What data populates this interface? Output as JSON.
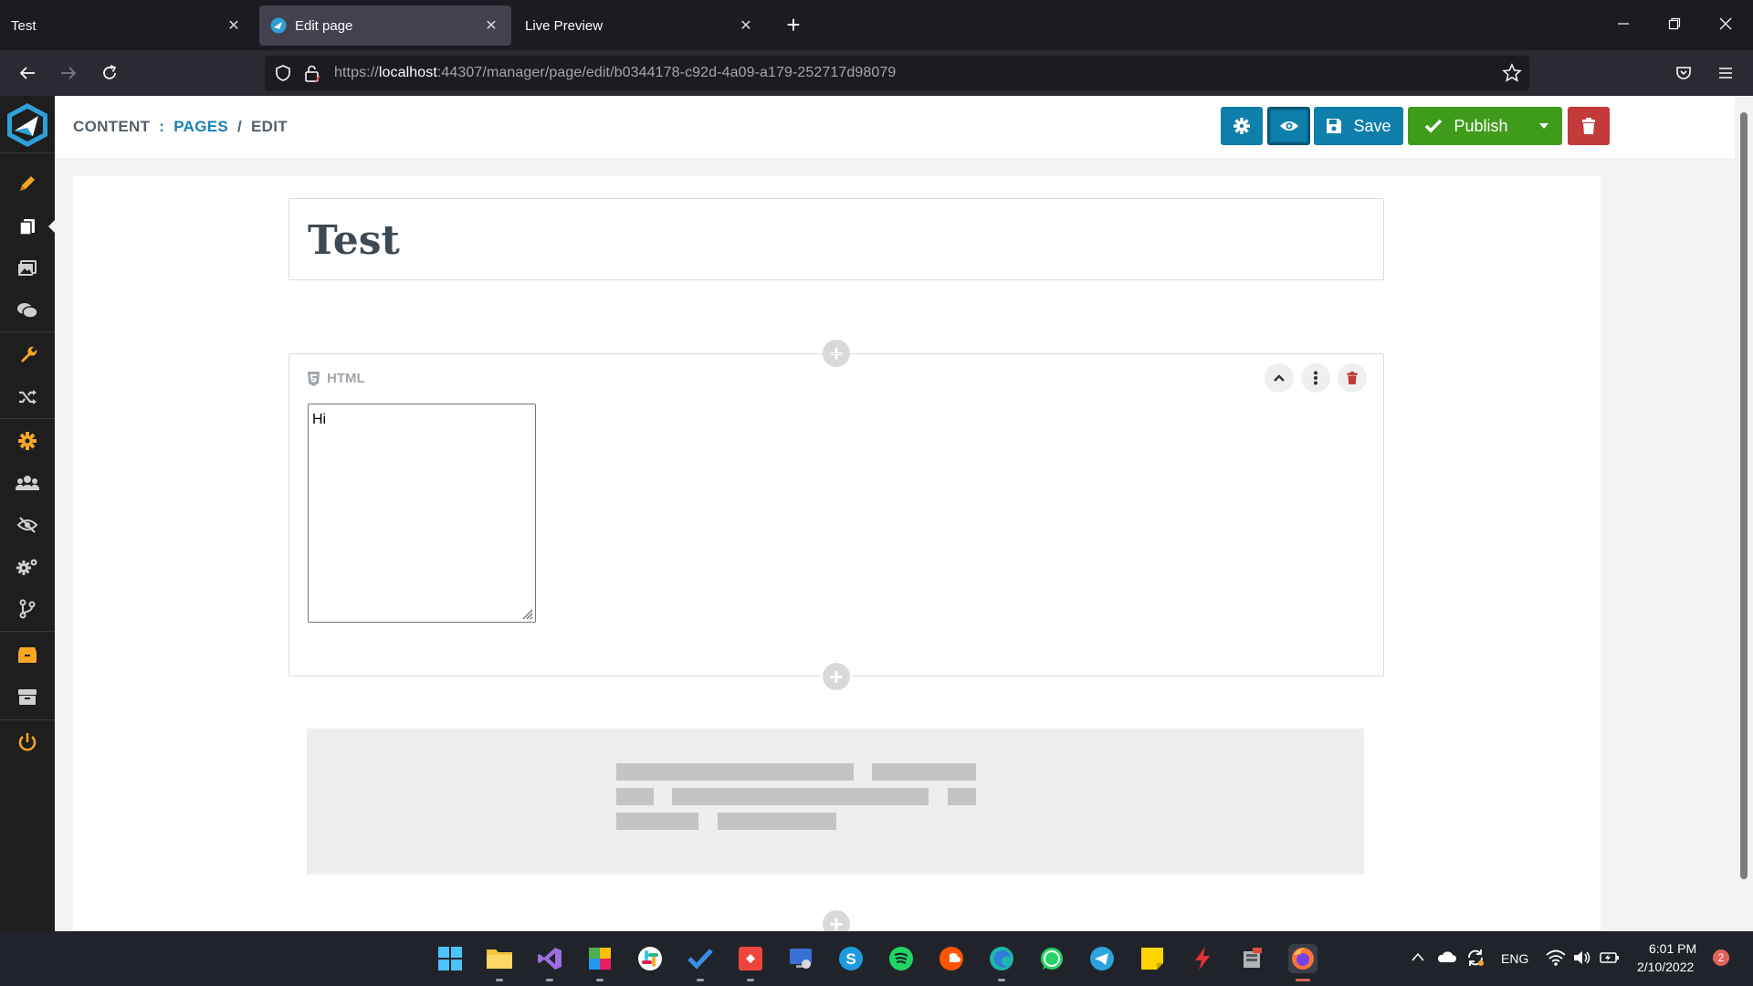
{
  "browser": {
    "tabs": [
      {
        "label": "Test"
      },
      {
        "label": "Edit page"
      },
      {
        "label": "Live Preview"
      }
    ],
    "url": {
      "scheme": "https://",
      "host": "localhost",
      "rest": ":44307/manager/page/edit/b0344178-c92d-4a09-a179-252717d98079"
    }
  },
  "sidebar": {
    "items": [
      {
        "icon": "pencil-icon",
        "color": "#f5a623"
      },
      {
        "icon": "pages-icon",
        "color": "#ffffff",
        "active": true
      },
      {
        "icon": "media-icon",
        "color": "#cfcfcf"
      },
      {
        "icon": "comments-icon",
        "color": "#cfcfcf"
      },
      {
        "icon": "wrench-icon",
        "color": "#f5a623"
      },
      {
        "icon": "shuffle-icon",
        "color": "#cfcfcf"
      },
      {
        "icon": "gear-icon",
        "color": "#f5a623"
      },
      {
        "icon": "users-icon",
        "color": "#cfcfcf"
      },
      {
        "icon": "eye-slash-icon",
        "color": "#cfcfcf"
      },
      {
        "icon": "gears-icon",
        "color": "#cfcfcf"
      },
      {
        "icon": "branch-icon",
        "color": "#cfcfcf"
      },
      {
        "icon": "box-icon",
        "color": "#f5a623"
      },
      {
        "icon": "archive-icon",
        "color": "#cfcfcf"
      },
      {
        "icon": "power-icon",
        "color": "#f5a623"
      }
    ]
  },
  "breadcrumb": {
    "root": "CONTENT",
    "sep1": ":",
    "section": "PAGES",
    "sep2": "/",
    "current": "EDIT"
  },
  "toolbar": {
    "save_label": "Save",
    "publish_label": "Publish"
  },
  "page": {
    "title": "Test"
  },
  "block": {
    "type_label": "HTML",
    "content": "Hi"
  },
  "taskbar": {
    "time": "6:01 PM",
    "date": "2/10/2022",
    "language": "ENG",
    "notification_count": "2"
  },
  "colors": {
    "accent_blue": "#0e7fab",
    "publish_green": "#3f9c1b",
    "danger_red": "#c23a3a",
    "sidebar_bg": "#1e1e1e"
  }
}
